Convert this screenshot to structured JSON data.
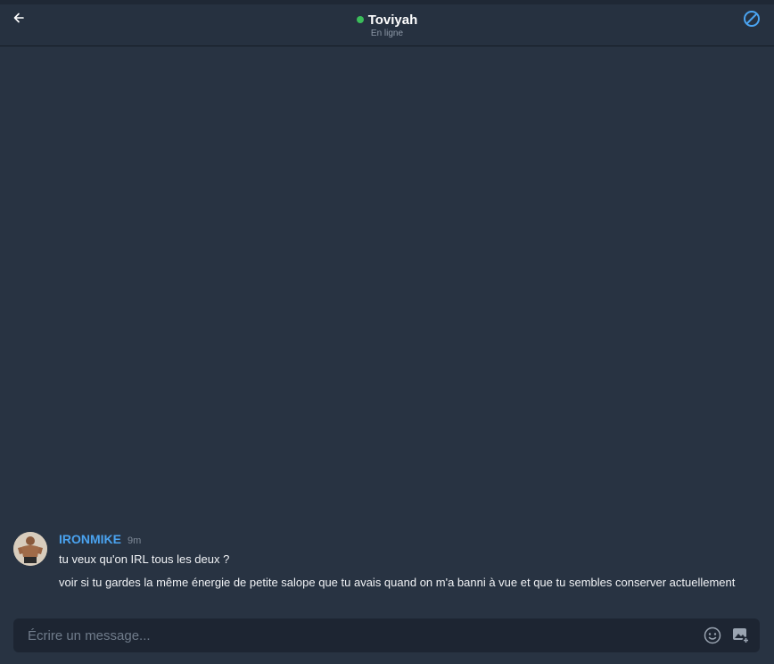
{
  "header": {
    "title": "Toviyah",
    "status": "En ligne",
    "status_color": "#3bbd5a",
    "back_icon": "arrow-left-icon",
    "block_icon": "block-icon"
  },
  "messages": [
    {
      "author": "IRONMIKE",
      "time": "9m",
      "author_color": "#4aa3f0",
      "lines": [
        "tu veux qu'on IRL tous les deux ?",
        "voir si tu gardes la même énergie de petite salope que tu avais quand on m'a banni à vue et que tu sembles conserver actuellement"
      ]
    }
  ],
  "composer": {
    "placeholder": "Écrire un message...",
    "value": "",
    "emoji_icon": "emoji-icon",
    "image_icon": "add-image-icon"
  },
  "colors": {
    "background": "#283342",
    "accent": "#4aa3f0"
  }
}
